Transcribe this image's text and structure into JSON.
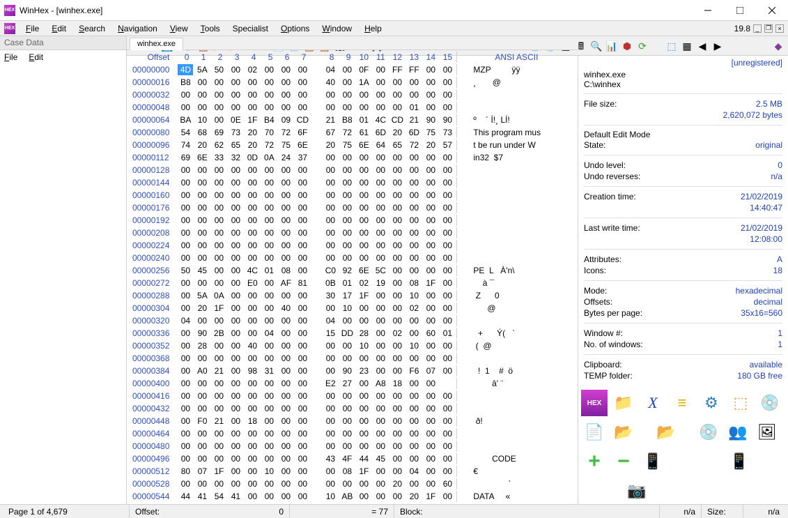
{
  "title": "WinHex - [winhex.exe]",
  "version": "19.8",
  "menus": [
    "File",
    "Edit",
    "Search",
    "Navigation",
    "View",
    "Tools",
    "Specialist",
    "Options",
    "Window",
    "Help"
  ],
  "menu_hotkeys": [
    "F",
    "E",
    "S",
    "N",
    "V",
    "T",
    "",
    "O",
    "W",
    "H"
  ],
  "case_panel": {
    "header": "Case Data",
    "menus": [
      "File",
      "Edit"
    ],
    "hk": [
      "F",
      "E"
    ]
  },
  "tab": "winhex.exe",
  "hex_header": {
    "offset": "Offset",
    "cols": [
      "0",
      "1",
      "2",
      "3",
      "4",
      "5",
      "6",
      "7",
      "8",
      "9",
      "10",
      "11",
      "12",
      "13",
      "14",
      "15"
    ],
    "ansi": "ANSI ASCII"
  },
  "rows": [
    {
      "o": "00000000",
      "b": [
        "4D",
        "5A",
        "50",
        "00",
        "02",
        "00",
        "00",
        "00",
        "04",
        "00",
        "0F",
        "00",
        "FF",
        "FF",
        "00",
        "00"
      ],
      "a": "MZP         ÿÿ  "
    },
    {
      "o": "00000016",
      "b": [
        "B8",
        "00",
        "00",
        "00",
        "00",
        "00",
        "00",
        "00",
        "40",
        "00",
        "1A",
        "00",
        "00",
        "00",
        "00",
        "00"
      ],
      "a": "¸       @       "
    },
    {
      "o": "00000032",
      "b": [
        "00",
        "00",
        "00",
        "00",
        "00",
        "00",
        "00",
        "00",
        "00",
        "00",
        "00",
        "00",
        "00",
        "00",
        "00",
        "00"
      ],
      "a": "                "
    },
    {
      "o": "00000048",
      "b": [
        "00",
        "00",
        "00",
        "00",
        "00",
        "00",
        "00",
        "00",
        "00",
        "00",
        "00",
        "00",
        "00",
        "01",
        "00",
        "00"
      ],
      "a": "                "
    },
    {
      "o": "00000064",
      "b": [
        "BA",
        "10",
        "00",
        "0E",
        "1F",
        "B4",
        "09",
        "CD",
        "21",
        "B8",
        "01",
        "4C",
        "CD",
        "21",
        "90",
        "90"
      ],
      "a": "º    ´ Í!¸ LÍ!  "
    },
    {
      "o": "00000080",
      "b": [
        "54",
        "68",
        "69",
        "73",
        "20",
        "70",
        "72",
        "6F",
        "67",
        "72",
        "61",
        "6D",
        "20",
        "6D",
        "75",
        "73"
      ],
      "a": "This program mus"
    },
    {
      "o": "00000096",
      "b": [
        "74",
        "20",
        "62",
        "65",
        "20",
        "72",
        "75",
        "6E",
        "20",
        "75",
        "6E",
        "64",
        "65",
        "72",
        "20",
        "57"
      ],
      "a": "t be run under W"
    },
    {
      "o": "00000112",
      "b": [
        "69",
        "6E",
        "33",
        "32",
        "0D",
        "0A",
        "24",
        "37",
        "00",
        "00",
        "00",
        "00",
        "00",
        "00",
        "00",
        "00"
      ],
      "a": "in32  $7        "
    },
    {
      "o": "00000128",
      "b": [
        "00",
        "00",
        "00",
        "00",
        "00",
        "00",
        "00",
        "00",
        "00",
        "00",
        "00",
        "00",
        "00",
        "00",
        "00",
        "00"
      ],
      "a": "                "
    },
    {
      "o": "00000144",
      "b": [
        "00",
        "00",
        "00",
        "00",
        "00",
        "00",
        "00",
        "00",
        "00",
        "00",
        "00",
        "00",
        "00",
        "00",
        "00",
        "00"
      ],
      "a": "                "
    },
    {
      "o": "00000160",
      "b": [
        "00",
        "00",
        "00",
        "00",
        "00",
        "00",
        "00",
        "00",
        "00",
        "00",
        "00",
        "00",
        "00",
        "00",
        "00",
        "00"
      ],
      "a": "                "
    },
    {
      "o": "00000176",
      "b": [
        "00",
        "00",
        "00",
        "00",
        "00",
        "00",
        "00",
        "00",
        "00",
        "00",
        "00",
        "00",
        "00",
        "00",
        "00",
        "00"
      ],
      "a": "                "
    },
    {
      "o": "00000192",
      "b": [
        "00",
        "00",
        "00",
        "00",
        "00",
        "00",
        "00",
        "00",
        "00",
        "00",
        "00",
        "00",
        "00",
        "00",
        "00",
        "00"
      ],
      "a": "                "
    },
    {
      "o": "00000208",
      "b": [
        "00",
        "00",
        "00",
        "00",
        "00",
        "00",
        "00",
        "00",
        "00",
        "00",
        "00",
        "00",
        "00",
        "00",
        "00",
        "00"
      ],
      "a": "                "
    },
    {
      "o": "00000224",
      "b": [
        "00",
        "00",
        "00",
        "00",
        "00",
        "00",
        "00",
        "00",
        "00",
        "00",
        "00",
        "00",
        "00",
        "00",
        "00",
        "00"
      ],
      "a": "                "
    },
    {
      "o": "00000240",
      "b": [
        "00",
        "00",
        "00",
        "00",
        "00",
        "00",
        "00",
        "00",
        "00",
        "00",
        "00",
        "00",
        "00",
        "00",
        "00",
        "00"
      ],
      "a": "                "
    },
    {
      "o": "00000256",
      "b": [
        "50",
        "45",
        "00",
        "00",
        "4C",
        "01",
        "08",
        "00",
        "C0",
        "92",
        "6E",
        "5C",
        "00",
        "00",
        "00",
        "00"
      ],
      "a": "PE  L   À'n\\    "
    },
    {
      "o": "00000272",
      "b": [
        "00",
        "00",
        "00",
        "00",
        "E0",
        "00",
        "AF",
        "81",
        "0B",
        "01",
        "02",
        "19",
        "00",
        "08",
        "1F",
        "00"
      ],
      "a": "    à ¯         "
    },
    {
      "o": "00000288",
      "b": [
        "00",
        "5A",
        "0A",
        "00",
        "00",
        "00",
        "00",
        "00",
        "30",
        "17",
        "1F",
        "00",
        "00",
        "10",
        "00",
        "00"
      ],
      "a": " Z      0       "
    },
    {
      "o": "00000304",
      "b": [
        "00",
        "20",
        "1F",
        "00",
        "00",
        "00",
        "40",
        "00",
        "00",
        "10",
        "00",
        "00",
        "00",
        "02",
        "00",
        "00"
      ],
      "a": "      @         "
    },
    {
      "o": "00000320",
      "b": [
        "04",
        "00",
        "00",
        "00",
        "00",
        "00",
        "00",
        "00",
        "04",
        "00",
        "00",
        "00",
        "00",
        "00",
        "00",
        "00"
      ],
      "a": "                "
    },
    {
      "o": "00000336",
      "b": [
        "00",
        "90",
        "2B",
        "00",
        "00",
        "04",
        "00",
        "00",
        "15",
        "DD",
        "28",
        "00",
        "02",
        "00",
        "60",
        "01"
      ],
      "a": "  +      Ý(   ` "
    },
    {
      "o": "00000352",
      "b": [
        "00",
        "28",
        "00",
        "00",
        "40",
        "00",
        "00",
        "00",
        "00",
        "00",
        "10",
        "00",
        "00",
        "10",
        "00",
        "00"
      ],
      "a": " (  @           "
    },
    {
      "o": "00000368",
      "b": [
        "00",
        "00",
        "00",
        "00",
        "00",
        "00",
        "00",
        "00",
        "00",
        "00",
        "00",
        "00",
        "00",
        "00",
        "00",
        "00"
      ],
      "a": "                "
    },
    {
      "o": "00000384",
      "b": [
        "00",
        "A0",
        "21",
        "00",
        "98",
        "31",
        "00",
        "00",
        "00",
        "90",
        "23",
        "00",
        "00",
        "F6",
        "07",
        "00"
      ],
      "a": "  !  1    #  ö  "
    },
    {
      "o": "00000400",
      "b": [
        "00",
        "00",
        "00",
        "00",
        "00",
        "00",
        "00",
        "00",
        "E2",
        "27",
        "00",
        "A8",
        "18",
        "00",
        "00",
        " "
      ],
      "a": "        â' ¨    "
    },
    {
      "o": "00000416",
      "b": [
        "00",
        "00",
        "00",
        "00",
        "00",
        "00",
        "00",
        "00",
        "00",
        "00",
        "00",
        "00",
        "00",
        "00",
        "00",
        "00"
      ],
      "a": "                "
    },
    {
      "o": "00000432",
      "b": [
        "00",
        "00",
        "00",
        "00",
        "00",
        "00",
        "00",
        "00",
        "00",
        "00",
        "00",
        "00",
        "00",
        "00",
        "00",
        "00"
      ],
      "a": "                "
    },
    {
      "o": "00000448",
      "b": [
        "00",
        "F0",
        "21",
        "00",
        "18",
        "00",
        "00",
        "00",
        "00",
        "00",
        "00",
        "00",
        "00",
        "00",
        "00",
        "00"
      ],
      "a": " ð!             "
    },
    {
      "o": "00000464",
      "b": [
        "00",
        "00",
        "00",
        "00",
        "00",
        "00",
        "00",
        "00",
        "00",
        "00",
        "00",
        "00",
        "00",
        "00",
        "00",
        "00"
      ],
      "a": "                "
    },
    {
      "o": "00000480",
      "b": [
        "00",
        "00",
        "00",
        "00",
        "00",
        "00",
        "00",
        "00",
        "00",
        "00",
        "00",
        "00",
        "00",
        "00",
        "00",
        "00"
      ],
      "a": "                "
    },
    {
      "o": "00000496",
      "b": [
        "00",
        "00",
        "00",
        "00",
        "00",
        "00",
        "00",
        "00",
        "43",
        "4F",
        "44",
        "45",
        "00",
        "00",
        "00",
        "00"
      ],
      "a": "        CODE    "
    },
    {
      "o": "00000512",
      "b": [
        "80",
        "07",
        "1F",
        "00",
        "00",
        "10",
        "00",
        "00",
        "00",
        "08",
        "1F",
        "00",
        "00",
        "04",
        "00",
        "00"
      ],
      "a": "€               "
    },
    {
      "o": "00000528",
      "b": [
        "00",
        "00",
        "00",
        "00",
        "00",
        "00",
        "00",
        "00",
        "00",
        "00",
        "00",
        "00",
        "20",
        "00",
        "00",
        "60"
      ],
      "a": "               `"
    },
    {
      "o": "00000544",
      "b": [
        "44",
        "41",
        "54",
        "41",
        "00",
        "00",
        "00",
        "00",
        "10",
        "AB",
        "00",
        "00",
        "00",
        "20",
        "1F",
        "00"
      ],
      "a": "DATA     «      "
    }
  ],
  "status": {
    "page": "Page 1 of 4,679",
    "offset_l": "Offset:",
    "offset_v": "0",
    "eq": "= 77",
    "block_l": "Block:",
    "block_v": "n/a",
    "size_l": "Size:",
    "size_v": "n/a"
  },
  "details": {
    "unreg": "[unregistered]",
    "filename": "winhex.exe",
    "path": "C:\\winhex",
    "fs_l": "File size:",
    "fs_v": "2.5 MB",
    "fs_b": "2,620,072 bytes",
    "mode_l": "Default Edit Mode",
    "state_l": "State:",
    "state_v": "original",
    "undo_l": "Undo level:",
    "undo_v": "0",
    "rev_l": "Undo reverses:",
    "rev_v": "n/a",
    "ct_l": "Creation time:",
    "ct_v": "21/02/2019",
    "ct_t": "14:40:47",
    "wt_l": "Last write time:",
    "wt_v": "21/02/2019",
    "wt_t": "12:08:00",
    "attr_l": "Attributes:",
    "attr_v": "A",
    "icons_l": "Icons:",
    "icons_v": "18",
    "mode2_l": "Mode:",
    "mode2_v": "hexadecimal",
    "off_l": "Offsets:",
    "off_v": "decimal",
    "bpp_l": "Bytes per page:",
    "bpp_v": "35x16=560",
    "win_l": "Window #:",
    "win_v": "1",
    "nwin_l": "No. of windows:",
    "nwin_v": "1",
    "clip_l": "Clipboard:",
    "clip_v": "available",
    "tmp_l": "TEMP folder:",
    "tmp_v": "180 GB free"
  }
}
